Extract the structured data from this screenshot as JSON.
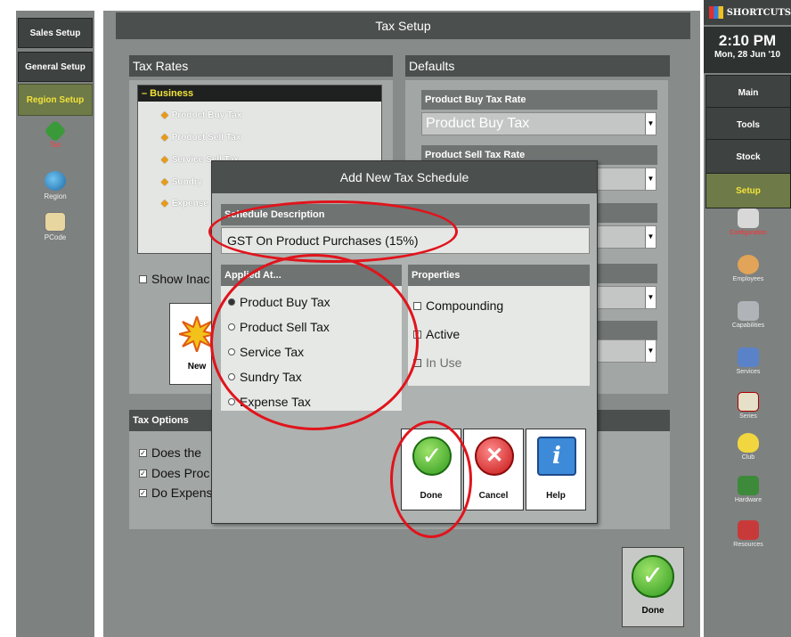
{
  "left_sidebar": {
    "buttons": [
      "Sales Setup",
      "General Setup",
      "Region Setup"
    ],
    "icons": [
      "Tax",
      "Region",
      "PCode"
    ]
  },
  "main": {
    "title": "Tax Setup",
    "tax_rates_title": "Tax Rates",
    "tree_root": "– Business",
    "tree_children": [
      "Product Buy Tax",
      "Product Sell Tax",
      "Service Sell Tax",
      "Sundry",
      "Expense"
    ],
    "show_inactive": "Show Inac",
    "new_label": "New",
    "defaults_title": "Defaults",
    "product_buy_header": "Product Buy Tax Rate",
    "product_buy_value": "Product Buy Tax",
    "product_sell_header": "Product Sell Tax Rate",
    "tax_options_title": "Tax Options",
    "tax_options": [
      "Does the",
      "Does Proc",
      "Do Expens"
    ],
    "done_label": "Done"
  },
  "right_sidebar": {
    "shortcuts": "SHORTCUTS",
    "time": "2:10 PM",
    "date": "Mon, 28 Jun '10",
    "buttons": [
      "Main",
      "Tools",
      "Stock",
      "Setup"
    ],
    "icons": [
      "Configuration",
      "Employees",
      "Capabilities",
      "Services",
      "Series",
      "Club",
      "Hardware",
      "Resources"
    ]
  },
  "dialog": {
    "title": "Add New Tax Schedule",
    "desc_header": "Schedule Description",
    "desc_value": "GST On Product Purchases (15%)",
    "applied_header": "Applied At...",
    "applied_options": [
      "Product Buy Tax",
      "Product Sell Tax",
      "Service Tax",
      "Sundry Tax",
      "Expense Tax"
    ],
    "properties_header": "Properties",
    "properties": [
      "Compounding",
      "Active",
      "In Use"
    ],
    "buttons": [
      "Done",
      "Cancel",
      "Help"
    ]
  }
}
